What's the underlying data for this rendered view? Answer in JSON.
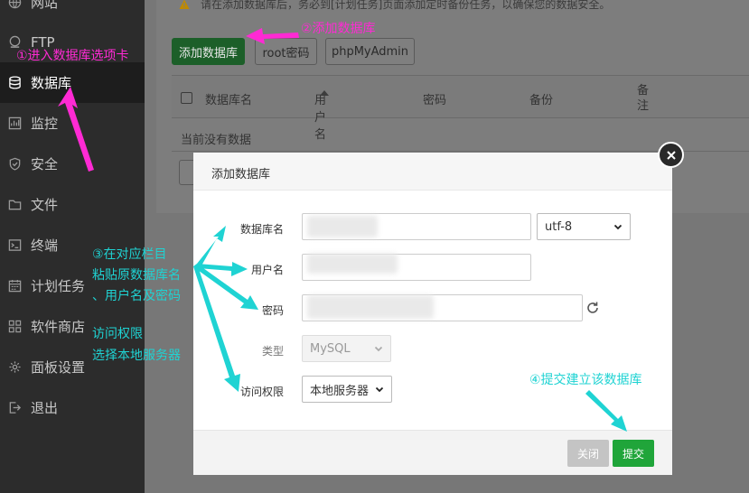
{
  "sidebar": {
    "items": [
      {
        "label": "网站",
        "icon": "globe-icon"
      },
      {
        "label": "FTP",
        "icon": "ftp-icon"
      },
      {
        "label": "数据库",
        "icon": "database-icon",
        "active": true
      },
      {
        "label": "监控",
        "icon": "monitor-icon"
      },
      {
        "label": "安全",
        "icon": "shield-icon"
      },
      {
        "label": "文件",
        "icon": "folder-icon"
      },
      {
        "label": "终端",
        "icon": "terminal-icon"
      },
      {
        "label": "计划任务",
        "icon": "calendar-icon"
      },
      {
        "label": "软件商店",
        "icon": "grid-icon"
      },
      {
        "label": "面板设置",
        "icon": "gear-icon"
      },
      {
        "label": "退出",
        "icon": "exit-icon"
      }
    ]
  },
  "main": {
    "warning": "请在添加数据库后，务必到[计划任务]页面添加定时备份任务，以确保您的数据安全。",
    "toolbar": {
      "add_db": "添加数据库",
      "root_pwd": "root密码",
      "phpmyadmin": "phpMyAdmin"
    },
    "table": {
      "headers": [
        "数据库名",
        "用户名",
        "密码",
        "备份",
        "备注"
      ],
      "empty": "当前没有数据"
    }
  },
  "modal": {
    "title": "添加数据库",
    "fields": {
      "db_name_label": "数据库名",
      "charset": "utf-8",
      "user_label": "用户名",
      "password_label": "密码",
      "type_label": "类型",
      "type_value": "MySQL",
      "access_label": "访问权限",
      "access_value": "本地服务器"
    },
    "buttons": {
      "close": "关闭",
      "submit": "提交"
    }
  },
  "annotations": {
    "step1": "①进入数据库选项卡",
    "step2": "②添加数据库",
    "step3_line1": "③在对应栏目",
    "step3_line2": "粘贴原数据库名",
    "step3_line3": "、用户名及密码",
    "access_line1": "访问权限",
    "access_line2": "选择本地服务器",
    "step4": "④提交建立该数据库"
  },
  "colors": {
    "pink": "#ff2ad4",
    "cyan": "#1fd3d3",
    "green": "#20a53a",
    "gray_btn": "#c4c4c4"
  }
}
